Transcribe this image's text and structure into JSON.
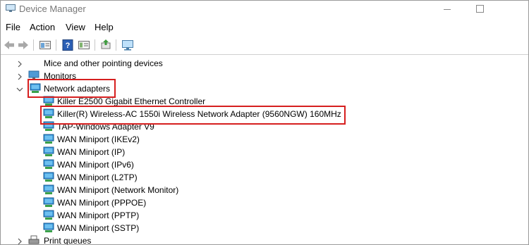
{
  "window": {
    "title": "Device Manager"
  },
  "menu": [
    "File",
    "Action",
    "View",
    "Help"
  ],
  "icons": {
    "toolbar": [
      "back-arrow-icon",
      "forward-arrow-icon",
      "properties-icon",
      "help-icon",
      "device-view-icon",
      "update-driver-icon",
      "monitor-icon"
    ],
    "adapter": "network-adapter-icon"
  },
  "colors": {
    "highlight": "#d61f1f",
    "adapter_icon": "#2f8fd8"
  },
  "tree": {
    "mice": "Mice and other pointing devices",
    "monitors": "Monitors",
    "network_adapters": "Network adapters",
    "adapters": [
      "Killer E2500 Gigabit Ethernet Controller",
      "Killer(R) Wireless-AC 1550i Wireless Network Adapter (9560NGW) 160MHz",
      "TAP-Windows Adapter V9",
      "WAN Miniport (IKEv2)",
      "WAN Miniport (IP)",
      "WAN Miniport (IPv6)",
      "WAN Miniport (L2TP)",
      "WAN Miniport (Network Monitor)",
      "WAN Miniport (PPPOE)",
      "WAN Miniport (PPTP)",
      "WAN Miniport (SSTP)"
    ],
    "print_queues": "Print queues"
  }
}
